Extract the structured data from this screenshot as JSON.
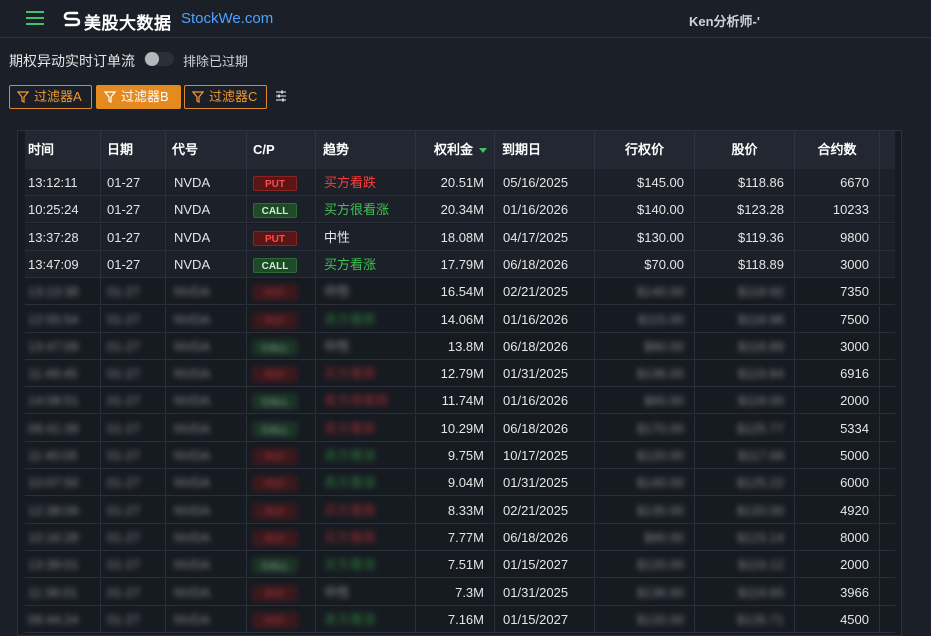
{
  "header": {
    "logo_cn": "美股大数据",
    "logo_en": "StockWe.com",
    "user": "Ken分析师-'"
  },
  "toolbar": {
    "page_label": "期权异动实时订单流",
    "toggle_label": "排除已过期",
    "toggle_on": false
  },
  "filters": [
    {
      "label": "过滤器A",
      "active": false
    },
    {
      "label": "过滤器B",
      "active": true
    },
    {
      "label": "过滤器C",
      "active": false
    }
  ],
  "colors": {
    "accent": "#e58a1f",
    "green": "#43c06a",
    "put_red": "#ff3b3b",
    "call_green": "#3fc24e",
    "link_blue": "#4ea3ff"
  },
  "table": {
    "columns": [
      "时间",
      "日期",
      "代号",
      "C/P",
      "趋势",
      "权利金",
      "到期日",
      "行权价",
      "股价",
      "合约数"
    ],
    "sorted_column": "权利金",
    "rows": [
      {
        "time": "13:12:11",
        "date": "01-27",
        "symbol": "NVDA",
        "cp": "PUT",
        "trend": "买方看跌",
        "trend_color": "red",
        "premium": "20.51M",
        "expiry": "05/16/2025",
        "strike": "$145.00",
        "price": "$118.86",
        "contracts": "6670",
        "blurred": false
      },
      {
        "time": "10:25:24",
        "date": "01-27",
        "symbol": "NVDA",
        "cp": "CALL",
        "trend": "买方很看涨",
        "trend_color": "green",
        "premium": "20.34M",
        "expiry": "01/16/2026",
        "strike": "$140.00",
        "price": "$123.28",
        "contracts": "10233",
        "blurred": false
      },
      {
        "time": "13:37:28",
        "date": "01-27",
        "symbol": "NVDA",
        "cp": "PUT",
        "trend": "中性",
        "trend_color": "neutral",
        "premium": "18.08M",
        "expiry": "04/17/2025",
        "strike": "$130.00",
        "price": "$119.36",
        "contracts": "9800",
        "blurred": false
      },
      {
        "time": "13:47:09",
        "date": "01-27",
        "symbol": "NVDA",
        "cp": "CALL",
        "trend": "买方看涨",
        "trend_color": "green",
        "premium": "17.79M",
        "expiry": "06/18/2026",
        "strike": "$70.00",
        "price": "$118.89",
        "contracts": "3000",
        "blurred": false
      },
      {
        "time": "13:13:38",
        "date": "01-27",
        "symbol": "NVDA",
        "cp": "PUT",
        "trend": "中性",
        "trend_color": "neutral",
        "premium": "16.54M",
        "expiry": "02/21/2025",
        "strike": "$140.00",
        "price": "$118.92",
        "contracts": "7350",
        "blurred": true
      },
      {
        "time": "12:55:54",
        "date": "01-27",
        "symbol": "NVDA",
        "cp": "PUT",
        "trend": "卖方看跌",
        "trend_color": "green",
        "premium": "14.06M",
        "expiry": "01/16/2026",
        "strike": "$115.00",
        "price": "$118.98",
        "contracts": "7500",
        "blurred": true
      },
      {
        "time": "13:47:09",
        "date": "01-27",
        "symbol": "NVDA",
        "cp": "CALL",
        "trend": "中性",
        "trend_color": "neutral",
        "premium": "13.8M",
        "expiry": "06/18/2026",
        "strike": "$90.00",
        "price": "$118.89",
        "contracts": "3000",
        "blurred": true
      },
      {
        "time": "11:49:45",
        "date": "01-27",
        "symbol": "NVDA",
        "cp": "PUT",
        "trend": "买方看跌",
        "trend_color": "red",
        "premium": "12.79M",
        "expiry": "01/31/2025",
        "strike": "$136.00",
        "price": "$119.84",
        "contracts": "6916",
        "blurred": true
      },
      {
        "time": "14:08:51",
        "date": "01-27",
        "symbol": "NVDA",
        "cp": "CALL",
        "trend": "卖方很看跌",
        "trend_color": "red",
        "premium": "11.74M",
        "expiry": "01/16/2026",
        "strike": "$65.00",
        "price": "$118.00",
        "contracts": "2000",
        "blurred": true
      },
      {
        "time": "09:41:39",
        "date": "01-27",
        "symbol": "NVDA",
        "cp": "CALL",
        "trend": "卖方看跌",
        "trend_color": "red",
        "premium": "10.29M",
        "expiry": "06/18/2026",
        "strike": "$170.00",
        "price": "$125.77",
        "contracts": "5334",
        "blurred": true
      },
      {
        "time": "11:40:05",
        "date": "01-27",
        "symbol": "NVDA",
        "cp": "PUT",
        "trend": "卖方看涨",
        "trend_color": "green",
        "premium": "9.75M",
        "expiry": "10/17/2025",
        "strike": "$120.00",
        "price": "$117.69",
        "contracts": "5000",
        "blurred": true
      },
      {
        "time": "10:07:50",
        "date": "01-27",
        "symbol": "NVDA",
        "cp": "PUT",
        "trend": "卖方看涨",
        "trend_color": "green",
        "premium": "9.04M",
        "expiry": "01/31/2025",
        "strike": "$140.00",
        "price": "$125.22",
        "contracts": "6000",
        "blurred": true
      },
      {
        "time": "12:38:09",
        "date": "01-27",
        "symbol": "NVDA",
        "cp": "PUT",
        "trend": "买方看跌",
        "trend_color": "red",
        "premium": "8.33M",
        "expiry": "02/21/2025",
        "strike": "$135.00",
        "price": "$120.00",
        "contracts": "4920",
        "blurred": true
      },
      {
        "time": "10:16:28",
        "date": "01-27",
        "symbol": "NVDA",
        "cp": "PUT",
        "trend": "买方看跌",
        "trend_color": "red",
        "premium": "7.77M",
        "expiry": "06/18/2026",
        "strike": "$90.00",
        "price": "$123.14",
        "contracts": "8000",
        "blurred": true
      },
      {
        "time": "13:39:01",
        "date": "01-27",
        "symbol": "NVDA",
        "cp": "CALL",
        "trend": "买方看涨",
        "trend_color": "green",
        "premium": "7.51M",
        "expiry": "01/15/2027",
        "strike": "$120.00",
        "price": "$119.12",
        "contracts": "2000",
        "blurred": true
      },
      {
        "time": "11:36:01",
        "date": "01-27",
        "symbol": "NVDA",
        "cp": "PUT",
        "trend": "中性",
        "trend_color": "neutral",
        "premium": "7.3M",
        "expiry": "01/31/2025",
        "strike": "$136.00",
        "price": "$119.65",
        "contracts": "3966",
        "blurred": true
      },
      {
        "time": "09:44:24",
        "date": "01-27",
        "symbol": "NVDA",
        "cp": "PUT",
        "trend": "卖方看涨",
        "trend_color": "green",
        "premium": "7.16M",
        "expiry": "01/15/2027",
        "strike": "$120.00",
        "price": "$126.71",
        "contracts": "4500",
        "blurred": true
      }
    ]
  }
}
